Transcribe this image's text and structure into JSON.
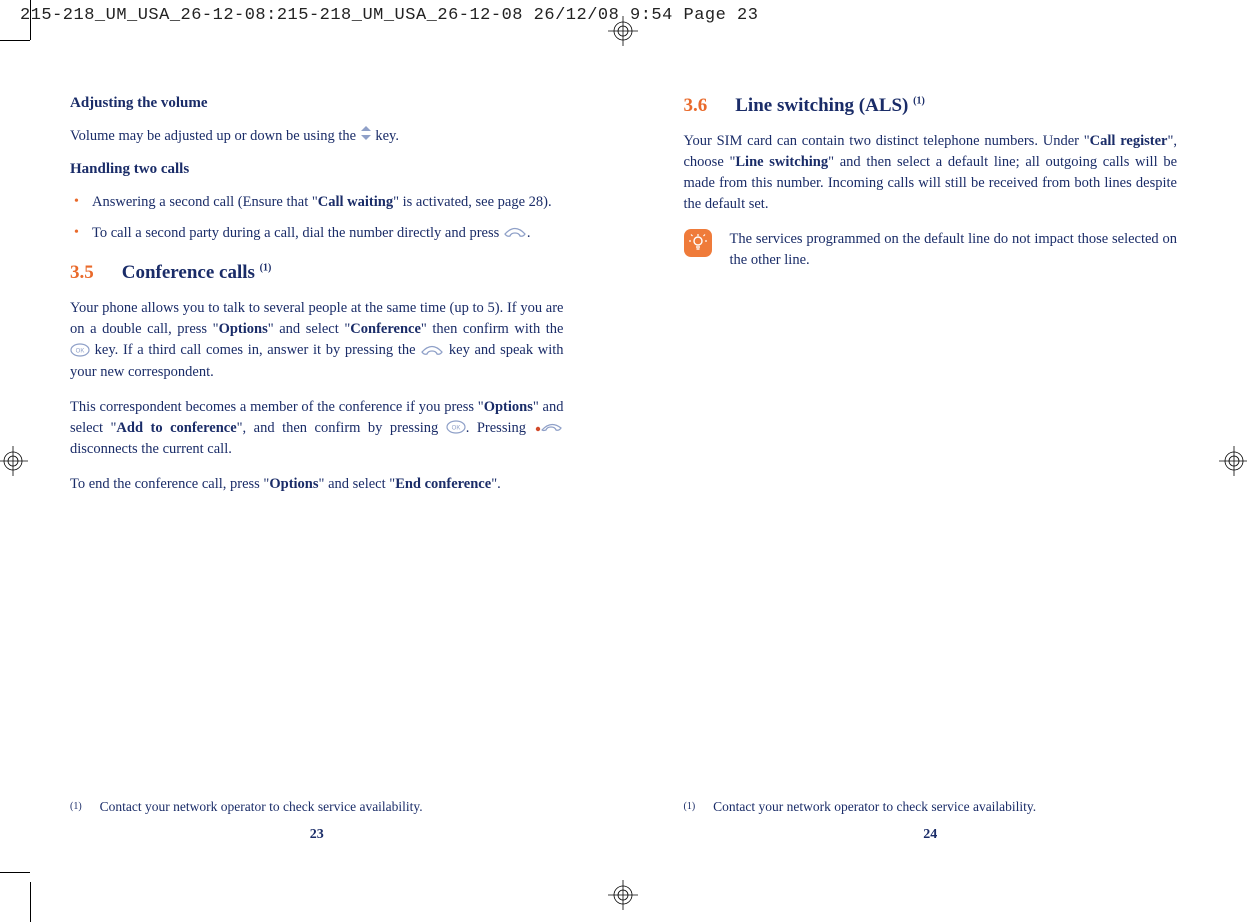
{
  "header": "215-218_UM_USA_26-12-08:215-218_UM_USA_26-12-08  26/12/08  9:54  Page 23",
  "left": {
    "adjusting_title": "Adjusting the volume",
    "adjusting_body_a": "Volume may be adjusted up or down be using the ",
    "adjusting_body_b": " key.",
    "handling_title": "Handling two calls",
    "bullet1_a": "Answering a second call (Ensure that \"",
    "bullet1_bold": "Call waiting",
    "bullet1_b": "\" is activated, see page 28).",
    "bullet2_a": "To call a second party during a call, dial the number directly and press ",
    "bullet2_b": ".",
    "sec35_num": "3.5",
    "sec35_title": "Conference calls ",
    "sec35_sup": "(1)",
    "p35a_1": "Your phone allows you to talk to several people at the same time (up to 5). If you are on a double call, press \"",
    "p35a_b1": "Options",
    "p35a_2": "\" and select \"",
    "p35a_b2": "Conference",
    "p35a_3": "\" then confirm with the ",
    "p35a_4": " key. If a third call comes in, answer it by pressing the ",
    "p35a_5": " key and speak with your new correspondent.",
    "p35b_1": "This correspondent becomes a member of the conference if you press \"",
    "p35b_b1": "Options",
    "p35b_2": "\" and select \"",
    "p35b_b2": "Add to conference",
    "p35b_3": "\", and then confirm by pressing ",
    "p35b_4": ". Pressing ",
    "p35b_5": " disconnects the current call.",
    "p35c_1": "To end the conference call, press \"",
    "p35c_b1": "Options",
    "p35c_2": "\" and select \"",
    "p35c_b2": "End conference",
    "p35c_3": "\".",
    "foot_marker": "(1)",
    "foot_text": "Contact your network operator to check service availability.",
    "page_num": "23"
  },
  "right": {
    "sec36_num": "3.6",
    "sec36_title": "Line switching (ALS) ",
    "sec36_sup": "(1)",
    "p36_1": "Your SIM card can contain two distinct telephone numbers. Under \"",
    "p36_b1": "Call register",
    "p36_2": "\", choose \"",
    "p36_b2": "Line switching",
    "p36_3": "\" and then select a default line; all outgoing calls will be made from this number. Incoming calls will still be received from both lines despite the default set.",
    "tip": "The services programmed on the default line do not impact those selected on the other line.",
    "foot_marker": "(1)",
    "foot_text": "Contact your network operator to check service availability.",
    "page_num": "24"
  }
}
